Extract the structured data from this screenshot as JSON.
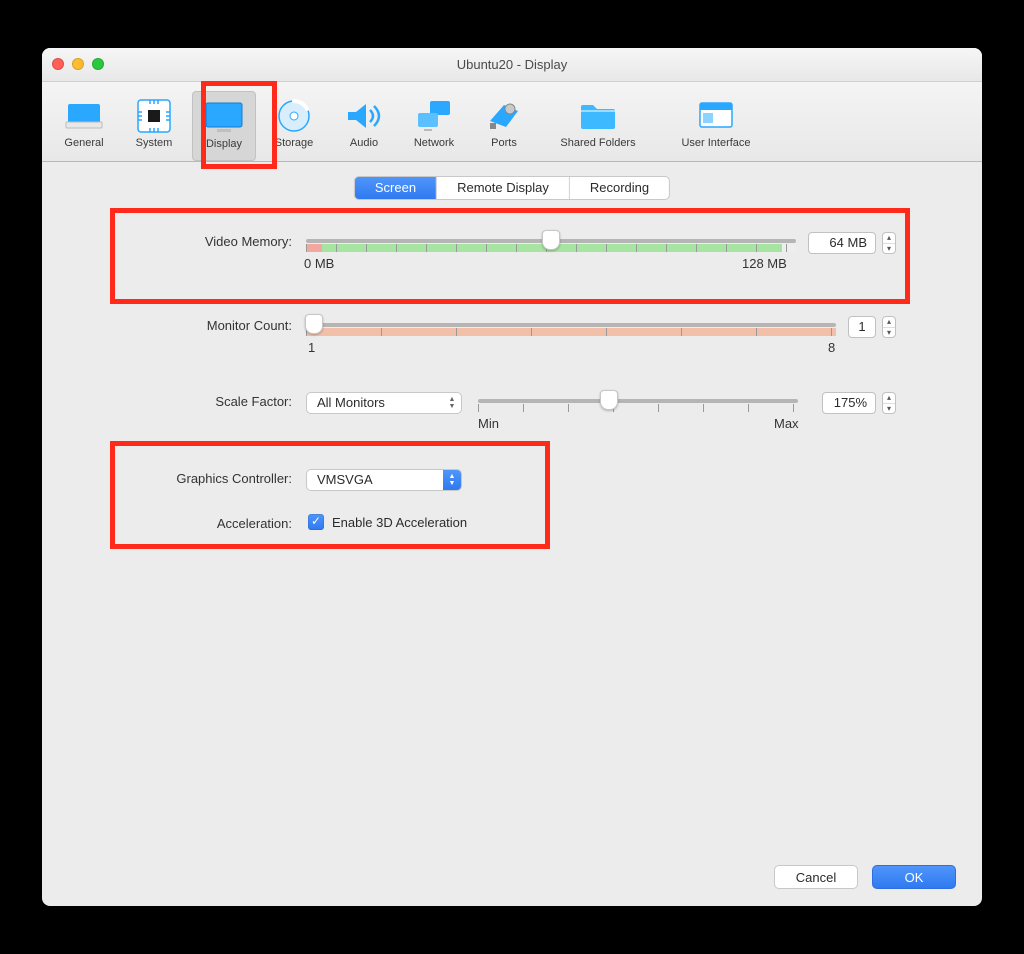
{
  "window_title": "Ubuntu20 - Display",
  "toolbar": {
    "items": [
      {
        "label": "General"
      },
      {
        "label": "System"
      },
      {
        "label": "Display"
      },
      {
        "label": "Storage"
      },
      {
        "label": "Audio"
      },
      {
        "label": "Network"
      },
      {
        "label": "Ports"
      },
      {
        "label": "Shared Folders"
      },
      {
        "label": "User Interface"
      }
    ]
  },
  "tabs": {
    "screen": "Screen",
    "remote": "Remote Display",
    "recording": "Recording"
  },
  "fields": {
    "video_memory": {
      "label": "Video Memory:",
      "value": "64 MB",
      "min_label": "0 MB",
      "max_label": "128 MB"
    },
    "monitor_count": {
      "label": "Monitor Count:",
      "value": "1",
      "min_label": "1",
      "max_label": "8"
    },
    "scale_factor": {
      "label": "Scale Factor:",
      "dropdown": "All Monitors",
      "value": "175%",
      "min_label": "Min",
      "max_label": "Max"
    },
    "graphics_controller": {
      "label": "Graphics Controller:",
      "value": "VMSVGA"
    },
    "acceleration": {
      "label": "Acceleration:",
      "checkbox_label": "Enable 3D Acceleration",
      "checked": true
    }
  },
  "footer": {
    "cancel": "Cancel",
    "ok": "OK"
  }
}
